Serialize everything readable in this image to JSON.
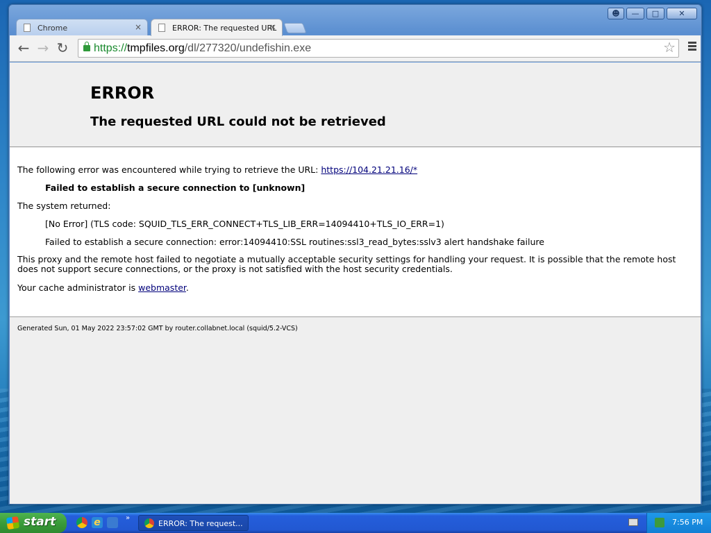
{
  "browser": {
    "tabs": [
      {
        "title": "Chrome",
        "active": false
      },
      {
        "title": "ERROR: The requested URL",
        "active": true
      }
    ],
    "close_glyph": "×",
    "url": {
      "scheme": "https://",
      "host": "tmpfiles.org",
      "path": "/dl/277320/undefishin.exe"
    }
  },
  "page": {
    "title": "ERROR",
    "subtitle": "The requested URL could not be retrieved",
    "intro": "The following error was encountered while trying to retrieve the URL: ",
    "intro_link": "https://104.21.21.16/*",
    "failed": "Failed to establish a secure connection to [unknown]",
    "system_returned": "The system returned:",
    "no_error": "[No Error] (TLS code: SQUID_TLS_ERR_CONNECT+TLS_LIB_ERR=14094410+TLS_IO_ERR=1)",
    "ssl_failure": "Failed to establish a secure connection: error:14094410:SSL routines:ssl3_read_bytes:sslv3 alert handshake failure",
    "explanation": "This proxy and the remote host failed to negotiate a mutually acceptable security settings for handling your request. It is possible that the remote host does not support secure connections, or the proxy is not satisfied with the host security credentials.",
    "admin_prefix": "Your cache administrator is ",
    "admin_link": "webmaster",
    "admin_suffix": ".",
    "footer": "Generated Sun, 01 May 2022 23:57:02 GMT by router.collabnet.local (squid/5.2-VCS)"
  },
  "taskbar": {
    "start_label": "start",
    "task_label": "ERROR: The request...",
    "clock": "7:56 PM"
  },
  "colors": {
    "url_scheme": "#1a8a2e",
    "link": "#00007a",
    "taskbar": "#245edb",
    "start": "#3a9c3a"
  }
}
